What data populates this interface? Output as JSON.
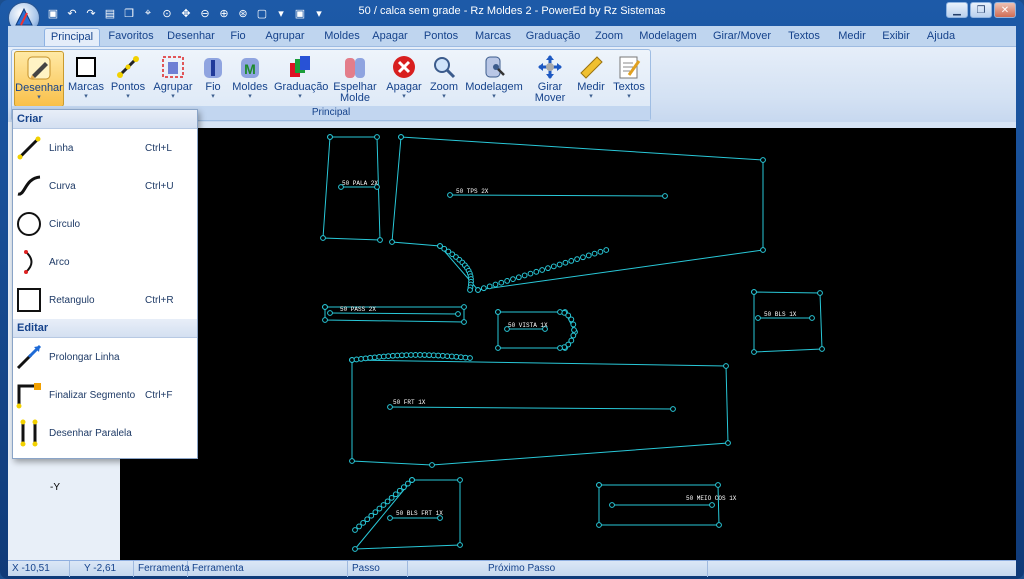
{
  "window": {
    "title": "50 / calca sem grade - Rz Moldes 2 - PowerEd by Rz Sistemas"
  },
  "tabs": [
    "Principal",
    "Favoritos",
    "Desenhar",
    "Fio",
    "Agrupar",
    "Moldes",
    "Apagar",
    "Pontos",
    "Marcas",
    "Graduação",
    "Zoom",
    "Modelagem",
    "Girar/Mover",
    "Textos",
    "Medir",
    "Exibir",
    "Ajuda"
  ],
  "ribbon": {
    "group_label": "Principal",
    "buttons": [
      {
        "l1": "Desenhar",
        "l2": ""
      },
      {
        "l1": "Marcas",
        "l2": ""
      },
      {
        "l1": "Pontos",
        "l2": ""
      },
      {
        "l1": "Agrupar",
        "l2": ""
      },
      {
        "l1": "Fio",
        "l2": ""
      },
      {
        "l1": "Moldes",
        "l2": ""
      },
      {
        "l1": "Graduação",
        "l2": ""
      },
      {
        "l1": "Espelhar",
        "l2": "Molde"
      },
      {
        "l1": "Apagar",
        "l2": ""
      },
      {
        "l1": "Zoom",
        "l2": ""
      },
      {
        "l1": "Modelagem",
        "l2": ""
      },
      {
        "l1": "Girar",
        "l2": "Mover"
      },
      {
        "l1": "Medir",
        "l2": ""
      },
      {
        "l1": "Textos",
        "l2": ""
      }
    ]
  },
  "menu": {
    "criar_header": "Criar",
    "editar_header": "Editar",
    "criar": [
      {
        "label": "Linha",
        "shortcut": "Ctrl+L"
      },
      {
        "label": "Curva",
        "shortcut": "Ctrl+U"
      },
      {
        "label": "Circulo",
        "shortcut": ""
      },
      {
        "label": "Arco",
        "shortcut": ""
      },
      {
        "label": "Retangulo",
        "shortcut": "Ctrl+R"
      }
    ],
    "editar": [
      {
        "label": "Prolongar Linha",
        "shortcut": ""
      },
      {
        "label": "Finalizar Segmento",
        "shortcut": "Ctrl+F"
      },
      {
        "label": "Desenhar Paralela",
        "shortcut": ""
      }
    ]
  },
  "canvas": {
    "axis_label": "-Y",
    "pieces": [
      "50 PALA 2X",
      "50 TPS 2X",
      "50 PASS 2X",
      "50 VISTA 1X",
      "50 BLS 1X",
      "50 FRT 1X",
      "50 BLS FRT 1X",
      "50 MEIO COS 1X"
    ]
  },
  "status": {
    "x": "X -10,51",
    "y": "Y -2,61",
    "tool1": "Ferramenta",
    "tool2": "Ferramenta",
    "step": "Passo",
    "next": "Próximo Passo"
  },
  "colors": {
    "pattern": "#29c8d8",
    "canvas_bg": "#000000"
  }
}
